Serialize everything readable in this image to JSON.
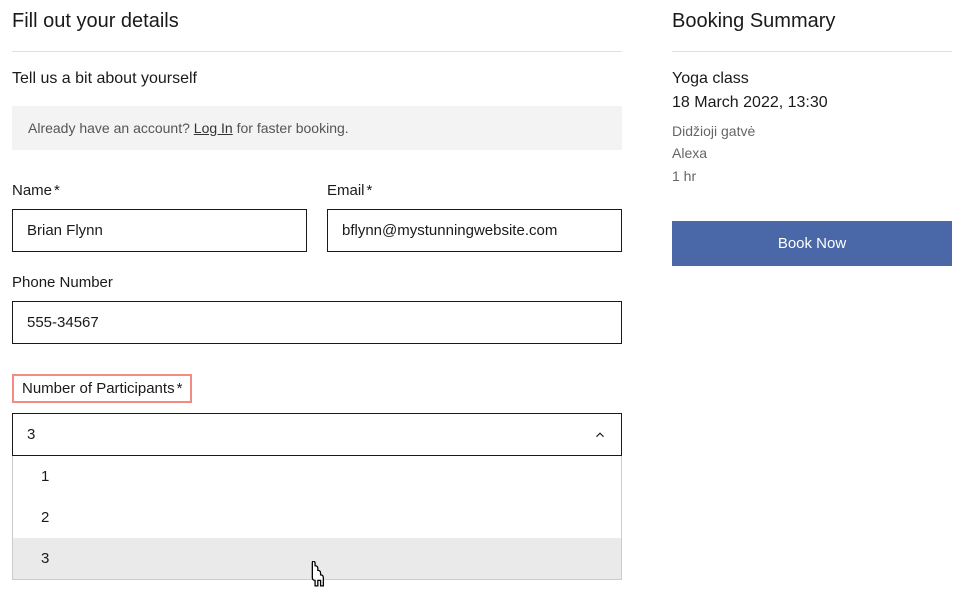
{
  "left": {
    "heading": "Fill out your details",
    "subheading": "Tell us a bit about yourself",
    "banner_prefix": "Already have an account? ",
    "banner_link": "Log In",
    "banner_suffix": " for faster booking.",
    "name_label": "Name",
    "name_value": "Brian Flynn",
    "email_label": "Email",
    "email_value": "bflynn@mystunningwebsite.com",
    "phone_label": "Phone Number",
    "phone_value": "555-34567",
    "participants_label": "Number of Participants",
    "participants_selected": "3",
    "participants_options": [
      "1",
      "2",
      "3"
    ],
    "required_star": "*"
  },
  "right": {
    "heading": "Booking Summary",
    "service": "Yoga class",
    "datetime": "18 March 2022, 13:30",
    "location": "Didžioji gatvė",
    "staff": "Alexa",
    "duration": "1 hr",
    "book_label": "Book Now"
  }
}
